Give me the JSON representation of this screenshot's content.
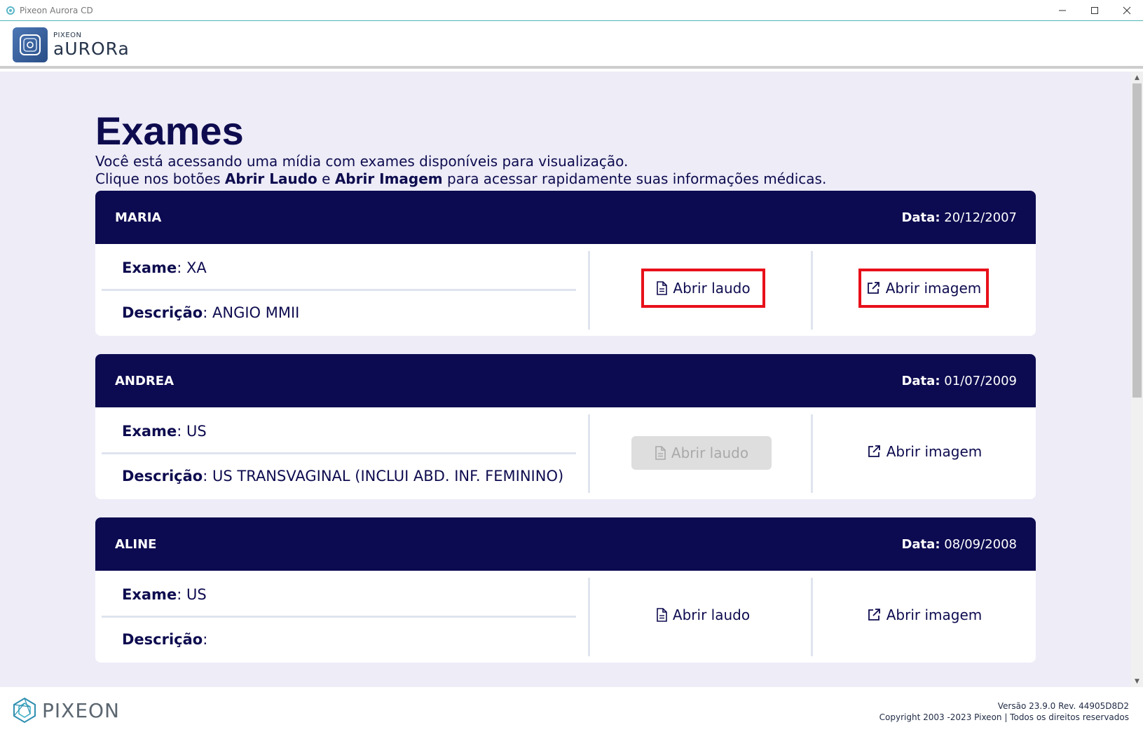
{
  "window": {
    "title": "Pixeon Aurora CD",
    "minimize_icon": "minimize-icon",
    "maximize_icon": "maximize-icon",
    "close_icon": "close-icon"
  },
  "header": {
    "logo_small": "PIXEON",
    "logo_big": "aURORa"
  },
  "main": {
    "title": "Exames",
    "intro_line1": "Você está acessando uma mídia com exames disponíveis para visualização.",
    "intro_line2_pre": "Clique nos botões ",
    "intro_line2_b1": "Abrir Laudo",
    "intro_line2_mid": " e ",
    "intro_line2_b2": "Abrir Imagem",
    "intro_line2_post": " para acessar rapidamente suas informações médicas."
  },
  "labels": {
    "date": "Data",
    "exam": "Exame",
    "description": "Descrição",
    "open_report": "Abrir laudo",
    "open_image": "Abrir imagem"
  },
  "exams": [
    {
      "patient": "MARIA",
      "date": "20/12/2007",
      "exam": "XA",
      "description": "ANGIO MMII",
      "report_enabled": true,
      "highlighted": true
    },
    {
      "patient": "ANDREA",
      "date": "01/07/2009",
      "exam": "US",
      "description": "US TRANSVAGINAL (INCLUI ABD. INF. FEMININO)",
      "report_enabled": false,
      "highlighted": false
    },
    {
      "patient": "ALINE",
      "date": "08/09/2008",
      "exam": "US",
      "description": "",
      "report_enabled": true,
      "highlighted": false
    }
  ],
  "footer": {
    "brand": "PIXEON",
    "version": "Versão 23.9.0 Rev. 44905D8D2",
    "copyright": "Copyright 2003 -2023 Pixeon | Todos os direitos reservados"
  },
  "colors": {
    "navy": "#0c0a50",
    "background": "#edecf7",
    "highlight_border": "#e8101a",
    "disabled_bg": "#dedede"
  }
}
